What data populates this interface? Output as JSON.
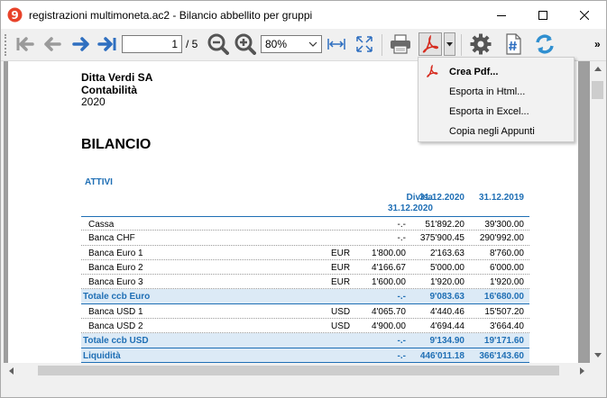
{
  "window": {
    "title": "registrazioni multimoneta.ac2 - Bilancio abbellito per gruppi"
  },
  "toolbar": {
    "page_current": "1",
    "page_total": "/ 5",
    "zoom": "80%",
    "overflow": "»"
  },
  "menu": {
    "items": [
      {
        "label": "Crea Pdf..."
      },
      {
        "label": "Esporta in Html..."
      },
      {
        "label": "Esporta in Excel..."
      },
      {
        "label": "Copia negli Appunti"
      }
    ]
  },
  "report": {
    "company": "Ditta Verdi SA",
    "subtitle": "Contabilità",
    "year": "2020",
    "title": "BILANCIO",
    "section": "ATTIVI",
    "headers": {
      "divisa_line1": "Divisa",
      "divisa_line2": "31.12.2020",
      "col_2020": "31.12.2020",
      "col_2019": "31.12.2019"
    },
    "rows": [
      {
        "desc": "Cassa",
        "cur": "",
        "div": "-.-",
        "y1": "51'892.20",
        "y2": "39'300.00",
        "total": false
      },
      {
        "desc": "Banca CHF",
        "cur": "",
        "div": "-.-",
        "y1": "375'900.45",
        "y2": "290'992.00",
        "total": false
      },
      {
        "desc": "Banca Euro 1",
        "cur": "EUR",
        "div": "1'800.00",
        "y1": "2'163.63",
        "y2": "8'760.00",
        "total": false
      },
      {
        "desc": "Banca Euro 2",
        "cur": "EUR",
        "div": "4'166.67",
        "y1": "5'000.00",
        "y2": "6'000.00",
        "total": false
      },
      {
        "desc": "Banca Euro 3",
        "cur": "EUR",
        "div": "1'600.00",
        "y1": "1'920.00",
        "y2": "1'920.00",
        "total": false
      },
      {
        "desc": "Totale ccb Euro",
        "cur": "",
        "div": "-.-",
        "y1": "9'083.63",
        "y2": "16'680.00",
        "total": true
      },
      {
        "desc": "Banca USD 1",
        "cur": "USD",
        "div": "4'065.70",
        "y1": "4'440.46",
        "y2": "15'507.20",
        "total": false
      },
      {
        "desc": "Banca USD 2",
        "cur": "USD",
        "div": "4'900.00",
        "y1": "4'694.44",
        "y2": "3'664.40",
        "total": false
      },
      {
        "desc": "Totale ccb USD",
        "cur": "",
        "div": "-.-",
        "y1": "9'134.90",
        "y2": "19'171.60",
        "total": true
      },
      {
        "desc": "Liquidità",
        "cur": "",
        "div": "-.-",
        "y1": "446'011.18",
        "y2": "366'143.60",
        "total": true
      }
    ]
  },
  "colors": {
    "accent_blue": "#1f6fb5",
    "total_row_bg": "#dceaf6",
    "pdf_red": "#d62b1f",
    "nav_blue": "#2f6fc0"
  }
}
